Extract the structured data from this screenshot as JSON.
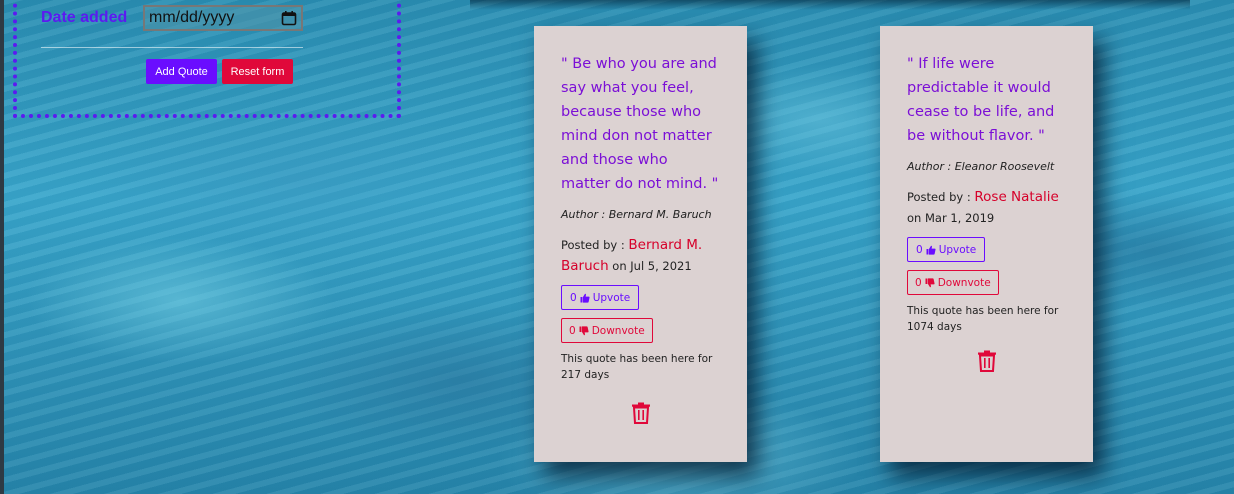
{
  "form": {
    "date_label": "Date added",
    "date_placeholder": "mm/dd/yyyy",
    "add_button": "Add Quote",
    "reset_button": "Reset form"
  },
  "quotes": [
    {
      "text": "\" Be who you are and say what you feel, because those who mind don not matter and those who matter do not mind. \"",
      "author": "Author : Bernard M. Baruch",
      "posted_prefix": "Posted by : ",
      "poster": "Bernard M. Baruch",
      "posted_date": " on Jul 5, 2021",
      "upvotes": "0",
      "upvote_label": "Upvote",
      "downvotes": "0",
      "downvote_label": "Downvote",
      "age": "This quote has been here for 217 days"
    },
    {
      "text": "\" If life were predictable it would cease to be life, and be without flavor. \"",
      "author": "Author : Eleanor Roosevelt",
      "posted_prefix": "Posted by : ",
      "poster": "Rose Natalie",
      "posted_date": " on Mar 1, 2019",
      "upvotes": "0",
      "upvote_label": "Upvote",
      "downvotes": "0",
      "downvote_label": "Downvote",
      "age": "This quote has been here for 1074 days"
    }
  ],
  "colors": {
    "accent": "#6a0dff",
    "danger": "#e0083a",
    "quote_text": "#7b0fd6",
    "card_bg": "#dcd2d2"
  },
  "icons": {
    "calendar": "calendar-icon",
    "upvote": "thumbs-up-icon",
    "downvote": "thumbs-down-icon",
    "delete": "trash-icon"
  }
}
